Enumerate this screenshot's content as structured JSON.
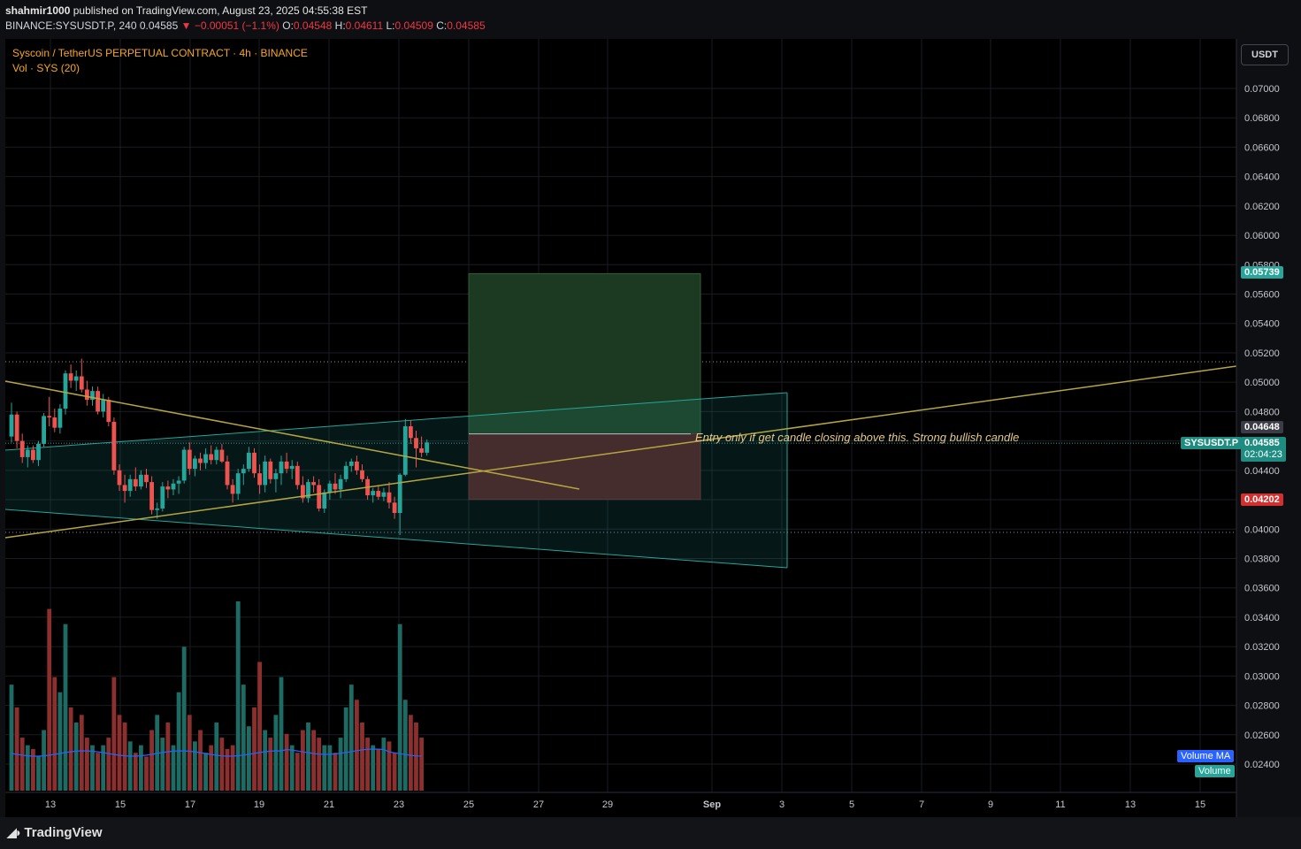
{
  "header": {
    "author": "shahmir1000",
    "published_text": "published on TradingView.com, August 23, 2025 04:55:38 EST",
    "symbol": "BINANCE:SYSUSDT.P, 240",
    "last": "0.04585",
    "change": "−0.00051 (−1.1%)",
    "o_label": "O:",
    "o": "0.04548",
    "h_label": "H:",
    "h": "0.04611",
    "l_label": "L:",
    "l": "0.04509",
    "c_label": "C:",
    "c": "0.04585"
  },
  "legend": {
    "title": "Syscoin / TetherUS PERPETUAL CONTRACT · 4h · BINANCE",
    "volume": "Vol · SYS (20)"
  },
  "currency_button": "USDT",
  "annotation": "Entry only if get candle closing above this. Strong bullish candle",
  "price_tags": {
    "target": "0.05739",
    "entry": "0.04648",
    "symbol": "SYSUSDT.P",
    "current": "0.04585",
    "countdown": "02:04:23",
    "stop": "0.04202"
  },
  "volume_tags": {
    "ma": "Volume MA",
    "vol": "Volume"
  },
  "footer": {
    "logo": "TradingView"
  },
  "colors": {
    "up": "#26a69a",
    "down": "#ef5350",
    "trendline": "#b5a642",
    "channel": "#26a69a",
    "target_zone": "#1c3a21",
    "stop_zone": "#4a1a1a",
    "volume_ma": "#2962ff",
    "background": "#0e0f12"
  },
  "chart_data": {
    "type": "candlestick",
    "timeframe": "4h",
    "x_ticks": [
      "13",
      "15",
      "17",
      "19",
      "21",
      "23",
      "25",
      "27",
      "29",
      "Sep",
      "3",
      "5",
      "7",
      "9",
      "11",
      "13",
      "15"
    ],
    "y_ticks": [
      "0.07000",
      "0.06800",
      "0.06600",
      "0.06400",
      "0.06200",
      "0.06000",
      "0.05800",
      "0.05600",
      "0.05400",
      "0.05200",
      "0.05000",
      "0.04800",
      "0.04600",
      "0.04400",
      "0.04200",
      "0.04000",
      "0.03800",
      "0.03600",
      "0.03400",
      "0.03200",
      "0.03000",
      "0.02800",
      "0.02600",
      "0.02400"
    ],
    "ylim": [
      0.0232,
      0.0718
    ],
    "candles": [
      [
        0.0463,
        0.0486,
        0.0459,
        0.0478
      ],
      [
        0.0478,
        0.048,
        0.0455,
        0.046
      ],
      [
        0.046,
        0.0465,
        0.0445,
        0.0449
      ],
      [
        0.0449,
        0.0457,
        0.0442,
        0.0454
      ],
      [
        0.0454,
        0.0457,
        0.0445,
        0.0447
      ],
      [
        0.0447,
        0.046,
        0.0443,
        0.0458
      ],
      [
        0.0458,
        0.0479,
        0.0456,
        0.0477
      ],
      [
        0.0477,
        0.049,
        0.047,
        0.0476
      ],
      [
        0.0476,
        0.0482,
        0.0466,
        0.0469
      ],
      [
        0.0469,
        0.0485,
        0.0465,
        0.0482
      ],
      [
        0.0482,
        0.0508,
        0.0478,
        0.0506
      ],
      [
        0.0506,
        0.0512,
        0.0496,
        0.0501
      ],
      [
        0.0501,
        0.0508,
        0.0494,
        0.0504
      ],
      [
        0.0504,
        0.0516,
        0.0493,
        0.0495
      ],
      [
        0.0495,
        0.0501,
        0.0484,
        0.0488
      ],
      [
        0.0488,
        0.0497,
        0.0484,
        0.0494
      ],
      [
        0.0494,
        0.0497,
        0.0478,
        0.048
      ],
      [
        0.048,
        0.0492,
        0.0476,
        0.0488
      ],
      [
        0.0488,
        0.049,
        0.047,
        0.0473
      ],
      [
        0.0473,
        0.0476,
        0.0437,
        0.044
      ],
      [
        0.044,
        0.0444,
        0.0426,
        0.043
      ],
      [
        0.043,
        0.0437,
        0.0418,
        0.0426
      ],
      [
        0.0426,
        0.0437,
        0.0422,
        0.0434
      ],
      [
        0.0434,
        0.0442,
        0.0426,
        0.0429
      ],
      [
        0.0429,
        0.044,
        0.0427,
        0.0437
      ],
      [
        0.0437,
        0.0441,
        0.0428,
        0.0432
      ],
      [
        0.0432,
        0.0436,
        0.041,
        0.0413
      ],
      [
        0.0413,
        0.0418,
        0.0407,
        0.0414
      ],
      [
        0.0414,
        0.0432,
        0.0412,
        0.0429
      ],
      [
        0.0429,
        0.0433,
        0.0421,
        0.0427
      ],
      [
        0.0427,
        0.0434,
        0.0423,
        0.0431
      ],
      [
        0.0431,
        0.0436,
        0.0424,
        0.0433
      ],
      [
        0.0433,
        0.0456,
        0.0431,
        0.0454
      ],
      [
        0.0454,
        0.0459,
        0.0437,
        0.0441
      ],
      [
        0.0441,
        0.045,
        0.0436,
        0.0448
      ],
      [
        0.0448,
        0.0452,
        0.044,
        0.0445
      ],
      [
        0.0445,
        0.0455,
        0.0441,
        0.0451
      ],
      [
        0.0451,
        0.0457,
        0.0444,
        0.0447
      ],
      [
        0.0447,
        0.0456,
        0.0444,
        0.0454
      ],
      [
        0.0454,
        0.0458,
        0.0445,
        0.0446
      ],
      [
        0.0446,
        0.045,
        0.0427,
        0.043
      ],
      [
        0.043,
        0.0434,
        0.0418,
        0.0424
      ],
      [
        0.0424,
        0.0441,
        0.042,
        0.0438
      ],
      [
        0.0438,
        0.0444,
        0.043,
        0.0441
      ],
      [
        0.0441,
        0.0456,
        0.0439,
        0.0452
      ],
      [
        0.0452,
        0.0455,
        0.0435,
        0.0438
      ],
      [
        0.0438,
        0.0444,
        0.0424,
        0.043
      ],
      [
        0.043,
        0.045,
        0.0425,
        0.0446
      ],
      [
        0.0446,
        0.0448,
        0.0431,
        0.0434
      ],
      [
        0.0434,
        0.0441,
        0.0425,
        0.0438
      ],
      [
        0.0438,
        0.045,
        0.043,
        0.0446
      ],
      [
        0.0446,
        0.0452,
        0.0438,
        0.0441
      ],
      [
        0.0441,
        0.0447,
        0.0434,
        0.0443
      ],
      [
        0.0443,
        0.0446,
        0.0427,
        0.043
      ],
      [
        0.043,
        0.0436,
        0.0418,
        0.0421
      ],
      [
        0.0421,
        0.0434,
        0.0418,
        0.0432
      ],
      [
        0.0432,
        0.0436,
        0.0425,
        0.043
      ],
      [
        0.043,
        0.0434,
        0.0412,
        0.0414
      ],
      [
        0.0414,
        0.0427,
        0.0411,
        0.0425
      ],
      [
        0.0425,
        0.0433,
        0.042,
        0.0431
      ],
      [
        0.0431,
        0.0438,
        0.0424,
        0.0427
      ],
      [
        0.0427,
        0.0437,
        0.0421,
        0.0434
      ],
      [
        0.0434,
        0.0446,
        0.0432,
        0.0443
      ],
      [
        0.0443,
        0.0448,
        0.0439,
        0.0446
      ],
      [
        0.0446,
        0.045,
        0.0437,
        0.044
      ],
      [
        0.044,
        0.0444,
        0.0432,
        0.0434
      ],
      [
        0.0434,
        0.0436,
        0.042,
        0.0423
      ],
      [
        0.0423,
        0.0428,
        0.0418,
        0.0426
      ],
      [
        0.0426,
        0.043,
        0.042,
        0.0422
      ],
      [
        0.0422,
        0.0428,
        0.0419,
        0.0425
      ],
      [
        0.0425,
        0.0432,
        0.0414,
        0.0418
      ],
      [
        0.0418,
        0.0422,
        0.0407,
        0.0411
      ],
      [
        0.0411,
        0.0438,
        0.0396,
        0.0437
      ],
      [
        0.0437,
        0.0475,
        0.0436,
        0.047
      ],
      [
        0.047,
        0.0474,
        0.0458,
        0.0462
      ],
      [
        0.0462,
        0.0467,
        0.0442,
        0.0455
      ],
      [
        0.0455,
        0.0463,
        0.0449,
        0.0452
      ],
      [
        0.0452,
        0.0461,
        0.045,
        0.0459
      ]
    ],
    "volume": [
      28,
      22,
      14,
      12,
      11,
      9,
      16,
      48,
      30,
      26,
      44,
      22,
      18,
      20,
      14,
      12,
      10,
      12,
      14,
      30,
      20,
      18,
      13,
      10,
      12,
      9,
      16,
      20,
      14,
      18,
      12,
      26,
      38,
      20,
      13,
      16,
      10,
      12,
      18,
      14,
      11,
      12,
      50,
      28,
      17,
      22,
      34,
      16,
      14,
      20,
      30,
      15,
      12,
      10,
      16,
      18,
      16,
      14,
      12,
      12,
      10,
      14,
      22,
      28,
      24,
      18,
      14,
      12,
      11,
      14,
      13,
      10,
      44,
      24,
      20,
      18,
      14
    ],
    "volume_ma_level": 13.5,
    "levels": {
      "target": 0.05739,
      "entry": 0.04648,
      "stop": 0.04202,
      "current": 0.04585
    },
    "volume_ylim": [
      0,
      80
    ]
  }
}
